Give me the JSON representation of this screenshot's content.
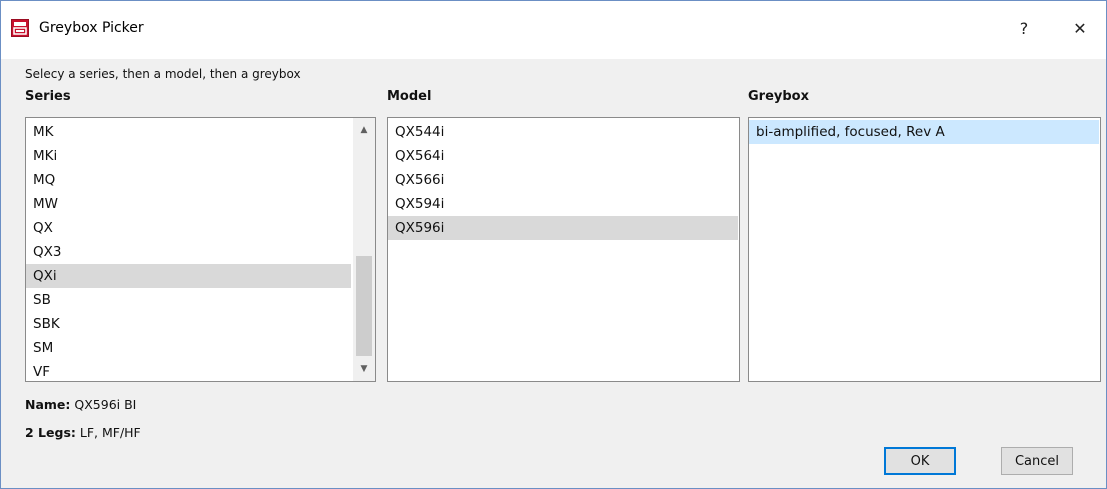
{
  "window": {
    "title": "Greybox Picker",
    "help_label": "?",
    "close_label": "✕"
  },
  "instruction": "Selecy a series, then a model, then a greybox",
  "series": {
    "header": "Series",
    "items": [
      "MK",
      "MKi",
      "MQ",
      "MW",
      "QX",
      "QX3",
      "QXi",
      "SB",
      "SBK",
      "SM",
      "VF"
    ],
    "selected": "QXi",
    "scroll_up_icon": "chevron-up-icon",
    "scroll_down_icon": "chevron-down-icon"
  },
  "model": {
    "header": "Model",
    "items": [
      "QX544i",
      "QX564i",
      "QX566i",
      "QX594i",
      "QX596i"
    ],
    "selected": "QX596i"
  },
  "greybox": {
    "header": "Greybox",
    "items": [
      "bi-amplified, focused, Rev A"
    ],
    "selected": "bi-amplified, focused, Rev A"
  },
  "info": {
    "name_label": "Name:",
    "name_value": "QX596i BI",
    "legs_label": "2 Legs:",
    "legs_value": "LF, MF/HF"
  },
  "buttons": {
    "ok": "OK",
    "cancel": "Cancel"
  },
  "colors": {
    "selection_grey": "#d9d9d9",
    "selection_blue": "#cce8ff",
    "default_button_border": "#0078d7",
    "app_icon_red": "#c8102e"
  }
}
